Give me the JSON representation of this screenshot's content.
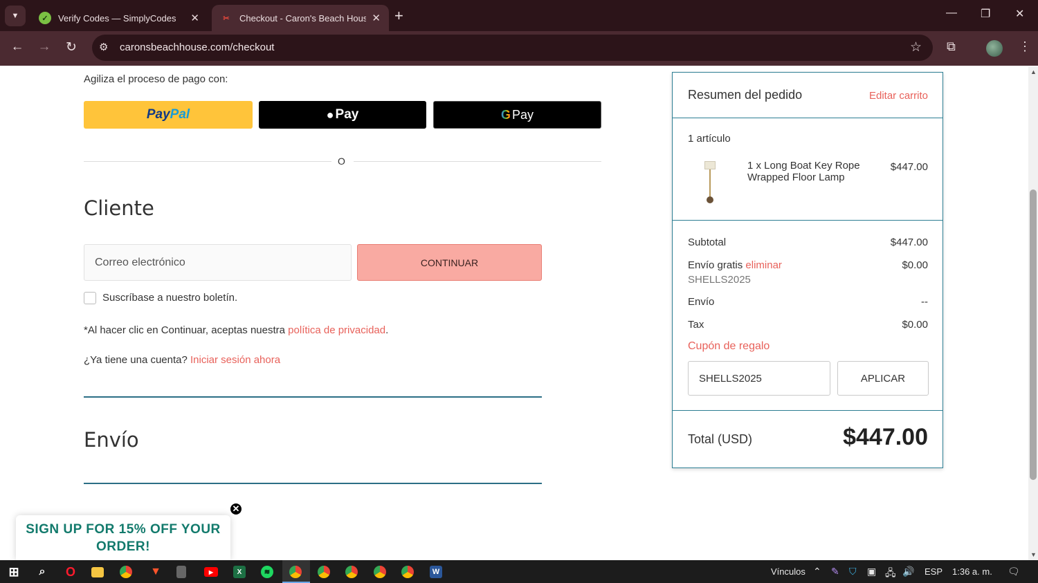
{
  "browser": {
    "tabs": [
      {
        "title": "Verify Codes — SimplyCodes",
        "active": false
      },
      {
        "title": "Checkout - Caron's Beach House",
        "active": true
      }
    ],
    "url": "caronsbeachhouse.com/checkout"
  },
  "express_checkout": {
    "label": "Agiliza el proceso de pago con:",
    "paypal_part1": "Pay",
    "paypal_part2": "Pal",
    "apple_pay": "Pay",
    "google_pay_g": "G",
    "google_pay": "Pay",
    "or_text": "O"
  },
  "customer": {
    "title": "Cliente",
    "email_placeholder": "Correo electrónico",
    "continue_label": "CONTINUAR",
    "newsletter_label": "Suscríbase a nuestro boletín.",
    "privacy_prefix": "*Al hacer clic en Continuar, aceptas nuestra ",
    "privacy_link": "política de privacidad",
    "privacy_suffix": ".",
    "account_prefix": "¿Ya tiene una cuenta? ",
    "login_link": "Iniciar sesión ahora"
  },
  "shipping": {
    "title": "Envío"
  },
  "summary": {
    "title": "Resumen del pedido",
    "edit_cart": "Editar carrito",
    "items_count": "1 artículo",
    "item_name": "1 x Long Boat Key Rope Wrapped Floor Lamp",
    "item_price": "$447.00",
    "subtotal_label": "Subtotal",
    "subtotal_value": "$447.00",
    "free_shipping_label": "Envío gratis",
    "remove_link": "eliminar",
    "free_shipping_value": "$0.00",
    "coupon_code": "SHELLS2025",
    "shipping_label": "Envío",
    "shipping_value": "--",
    "tax_label": "Tax",
    "tax_value": "$0.00",
    "gift_coupon_label": "Cupón de regalo",
    "coupon_input_value": "SHELLS2025",
    "apply_label": "APLICAR",
    "total_label": "Total (USD)",
    "total_value": "$447.00"
  },
  "promo": {
    "text": "SIGN UP FOR 15% OFF YOUR ORDER!"
  },
  "taskbar": {
    "links_label": "Vínculos",
    "language": "ESP",
    "time": "1:36 a. m."
  },
  "colors": {
    "browser_dark": "#2c1419",
    "accent_link": "#e8615a",
    "continue_button": "#f9aaa2",
    "teal_border": "#2b7d92",
    "promo_green": "#127a6c"
  }
}
